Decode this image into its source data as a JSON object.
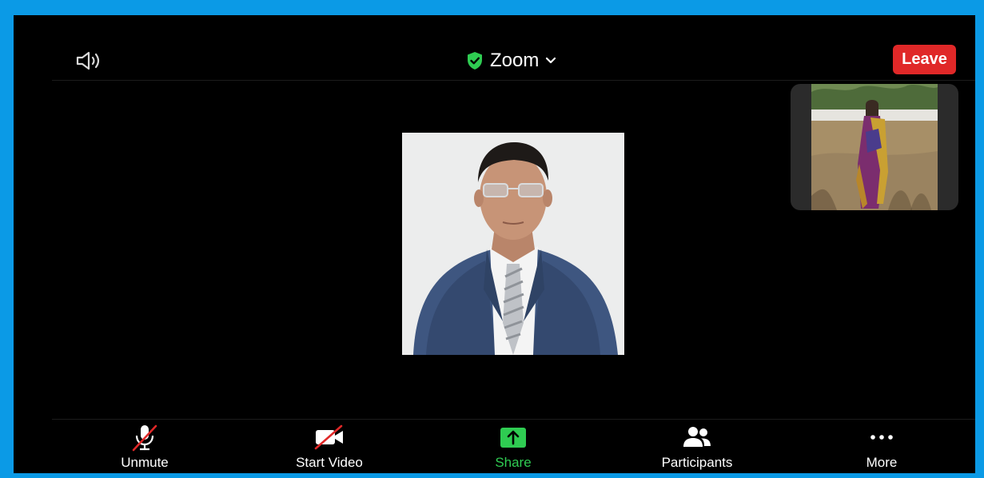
{
  "meeting": {
    "title": "Zoom",
    "secure_color": "#2fcc52"
  },
  "topbar": {
    "speaker_icon": "speaker-icon",
    "leave_label": "Leave",
    "leave_color": "#e02828"
  },
  "toolbar": {
    "items": [
      {
        "label": "Unmute",
        "icon": "muted-microphone-icon"
      },
      {
        "label": "Start Video",
        "icon": "video-off-icon"
      },
      {
        "label": "Share",
        "icon": "share-screen-icon"
      },
      {
        "label": "Participants",
        "icon": "participants-icon"
      },
      {
        "label": "More",
        "icon": "more-dots-icon"
      }
    ]
  }
}
